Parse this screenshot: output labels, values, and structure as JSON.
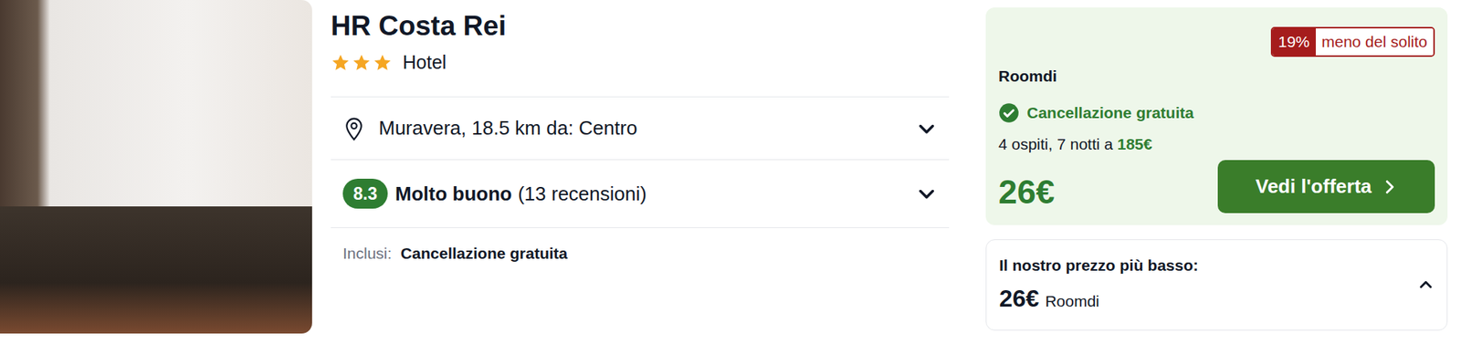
{
  "hotel": {
    "name": "HR Costa Rei",
    "stars": 3,
    "type": "Hotel",
    "location": {
      "text": "Muravera, 18.5 km da: Centro",
      "expanded": false
    },
    "rating": {
      "score": "8.3",
      "label": "Molto buono",
      "reviews": "(13 recensioni)",
      "expanded": false
    },
    "included": {
      "label": "Inclusi:",
      "value": "Cancellazione gratuita"
    }
  },
  "offer": {
    "discount": "19%",
    "discount_label": "meno del solito",
    "provider": "Roomdi",
    "cancellation": "Cancellazione gratuita",
    "stay": "4 ospiti, 7 notti a ",
    "total": "185€",
    "price": "26€",
    "button": "Vedi l'offerta"
  },
  "lowest": {
    "label": "Il nostro prezzo più basso:",
    "price": "26€",
    "provider": "Roomdi",
    "expanded": true
  }
}
